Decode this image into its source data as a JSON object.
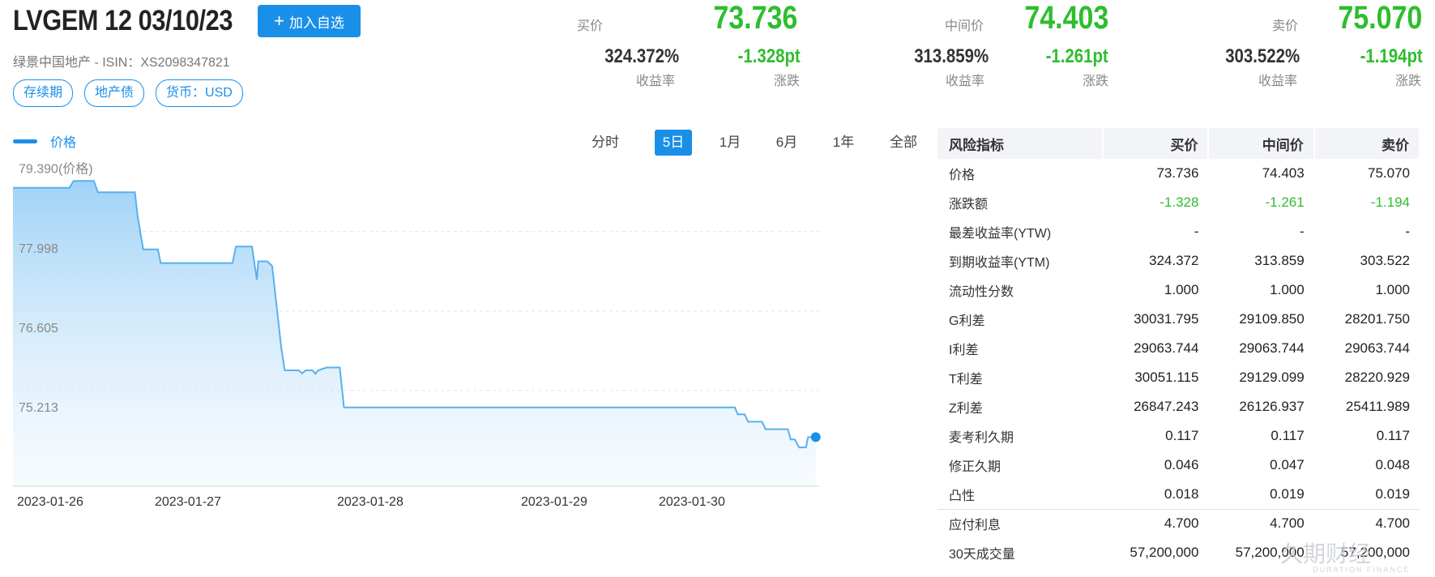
{
  "header": {
    "title": "LVGEM 12 03/10/23",
    "add_button": "加入自选",
    "subtitle": "绿景中国地产 - ISIN：XS2098347821",
    "tags": [
      "存续期",
      "地产债",
      "货币：USD"
    ]
  },
  "quotes": [
    {
      "label": "买价",
      "price": "73.736",
      "yield": "324.372%",
      "yield_label": "收益率",
      "change": "-1.328pt",
      "change_label": "涨跌"
    },
    {
      "label": "中间价",
      "price": "74.403",
      "yield": "313.859%",
      "yield_label": "收益率",
      "change": "-1.261pt",
      "change_label": "涨跌"
    },
    {
      "label": "卖价",
      "price": "75.070",
      "yield": "303.522%",
      "yield_label": "收益率",
      "change": "-1.194pt",
      "change_label": "涨跌"
    }
  ],
  "chart_controls": {
    "legend": "价格",
    "ranges": [
      "分时",
      "5日",
      "1月",
      "6月",
      "1年",
      "全部"
    ],
    "active_range": "5日"
  },
  "chart_data": {
    "type": "area",
    "series": [
      {
        "name": "价格"
      }
    ],
    "y_ticks": [
      "79.390(价格)",
      "77.998",
      "76.605",
      "75.213"
    ],
    "y_tick_values": [
      79.39,
      77.998,
      76.605,
      75.213
    ],
    "x_ticks": [
      "2023-01-26",
      "2023-01-27",
      "2023-01-28",
      "2023-01-29",
      "2023-01-30"
    ],
    "ylim": [
      73.82,
      79.5
    ],
    "grid": true,
    "points": [
      [
        0.0,
        79.05
      ],
      [
        0.081,
        79.05
      ],
      [
        0.087,
        79.17
      ],
      [
        0.116,
        79.17
      ],
      [
        0.122,
        78.97
      ],
      [
        0.175,
        78.97
      ],
      [
        0.179,
        78.55
      ],
      [
        0.183,
        78.25
      ],
      [
        0.187,
        77.97
      ],
      [
        0.208,
        77.97
      ],
      [
        0.212,
        77.73
      ],
      [
        0.278,
        77.73
      ],
      [
        0.282,
        77.73
      ],
      [
        0.315,
        77.73
      ],
      [
        0.32,
        78.02
      ],
      [
        0.343,
        78.02
      ],
      [
        0.35,
        77.44
      ],
      [
        0.352,
        77.76
      ],
      [
        0.365,
        77.76
      ],
      [
        0.372,
        77.68
      ],
      [
        0.385,
        76.25
      ],
      [
        0.39,
        75.85
      ],
      [
        0.41,
        75.85
      ],
      [
        0.415,
        75.8
      ],
      [
        0.42,
        75.85
      ],
      [
        0.43,
        75.85
      ],
      [
        0.434,
        75.79
      ],
      [
        0.438,
        75.85
      ],
      [
        0.45,
        75.9
      ],
      [
        0.469,
        75.9
      ],
      [
        0.475,
        75.2
      ],
      [
        1.036,
        75.2
      ],
      [
        1.04,
        75.08
      ],
      [
        1.05,
        75.08
      ],
      [
        1.055,
        74.95
      ],
      [
        1.075,
        74.95
      ],
      [
        1.08,
        74.82
      ],
      [
        1.112,
        74.82
      ],
      [
        1.116,
        74.64
      ],
      [
        1.122,
        74.64
      ],
      [
        1.128,
        74.5
      ],
      [
        1.138,
        74.5
      ],
      [
        1.141,
        74.68
      ],
      [
        1.152,
        74.68
      ]
    ]
  },
  "risk_table": {
    "headers": [
      "风险指标",
      "买价",
      "中间价",
      "卖价"
    ],
    "rows": [
      [
        "价格",
        "73.736",
        "74.403",
        "75.070"
      ],
      [
        "涨跌额",
        "-1.328",
        "-1.261",
        "-1.194"
      ],
      [
        "最差收益率(YTW)",
        "-",
        "-",
        "-"
      ],
      [
        "到期收益率(YTM)",
        "324.372",
        "313.859",
        "303.522"
      ],
      [
        "流动性分数",
        "1.000",
        "1.000",
        "1.000"
      ],
      [
        "G利差",
        "30031.795",
        "29109.850",
        "28201.750"
      ],
      [
        "I利差",
        "29063.744",
        "29063.744",
        "29063.744"
      ],
      [
        "T利差",
        "30051.115",
        "29129.099",
        "28220.929"
      ],
      [
        "Z利差",
        "26847.243",
        "26126.937",
        "25411.989"
      ],
      [
        "麦考利久期",
        "0.117",
        "0.117",
        "0.117"
      ],
      [
        "修正久期",
        "0.046",
        "0.047",
        "0.048"
      ],
      [
        "凸性",
        "0.018",
        "0.019",
        "0.019"
      ],
      [
        "应付利息",
        "4.700",
        "4.700",
        "4.700"
      ],
      [
        "30天成交量",
        "57,200,000",
        "57,200,000",
        "57,200,000"
      ]
    ]
  },
  "watermark": {
    "text": "久期财经",
    "sub": "DURATION FINANCE"
  },
  "colors": {
    "accent": "#1a8fe8",
    "down": "#2ebd2e"
  }
}
